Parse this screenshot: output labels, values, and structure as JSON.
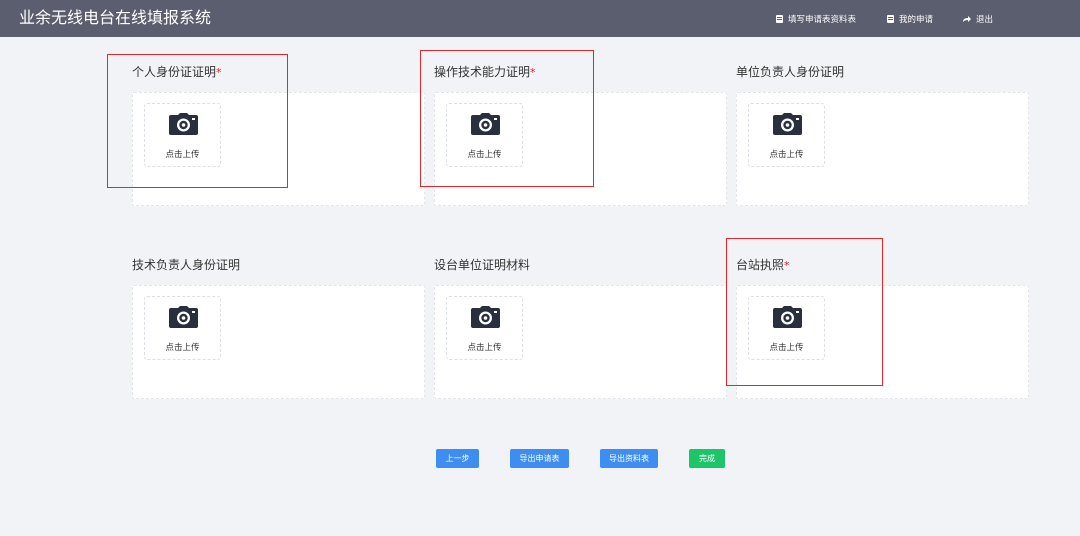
{
  "header": {
    "title": "业余无线电台在线填报系统",
    "nav": [
      {
        "label": "填写申请表资料表",
        "icon": "document-icon"
      },
      {
        "label": "我的申请",
        "icon": "list-icon"
      },
      {
        "label": "退出",
        "icon": "share-icon"
      }
    ]
  },
  "uploads": [
    {
      "label": "个人身份证证明",
      "required_mark": "*",
      "upload_text": "点击上传"
    },
    {
      "label": "操作技术能力证明",
      "required_mark": "*",
      "upload_text": "点击上传"
    },
    {
      "label": "单位负责人身份证明",
      "required_mark": "",
      "upload_text": "点击上传"
    },
    {
      "label": "技术负责人身份证明",
      "required_mark": "",
      "upload_text": "点击上传"
    },
    {
      "label": "设台单位证明材料",
      "required_mark": "",
      "upload_text": "点击上传"
    },
    {
      "label": "台站执照",
      "required_mark": "*",
      "upload_text": "点击上传"
    }
  ],
  "actions": {
    "prev": "上一步",
    "export_form": "导出申请表",
    "export_data": "导出资料表",
    "finish": "完成"
  },
  "colors": {
    "header_bg": "#5a5e6f",
    "page_bg": "#f2f3f7",
    "primary": "#3d8ef0",
    "success": "#1cc46a",
    "highlight": "#e5262a",
    "required": "#e02020"
  }
}
